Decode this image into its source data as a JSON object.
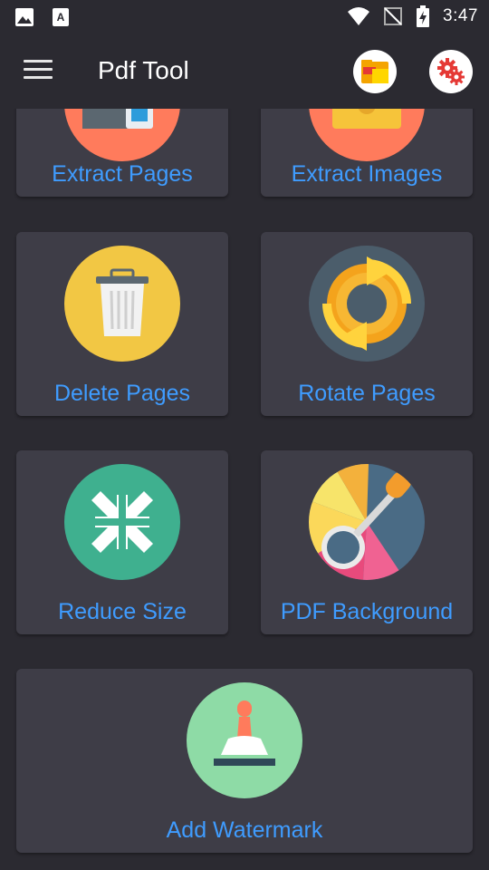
{
  "status_bar": {
    "time": "3:47",
    "left_icons": [
      "image-icon",
      "font-icon"
    ],
    "right_icons": [
      "wifi-icon",
      "no-signal-icon",
      "battery-charging-icon"
    ]
  },
  "app_bar": {
    "title": "Pdf Tool",
    "menu_icon": "hamburger-icon",
    "actions": [
      "folder-icon",
      "settings-gears-icon"
    ]
  },
  "tools": [
    {
      "label": "Extract Pages",
      "icon": "extract-pages-icon",
      "color": "#ff7b5c"
    },
    {
      "label": "Extract Images",
      "icon": "extract-images-icon",
      "color": "#ff7b5c"
    },
    {
      "label": "Delete Pages",
      "icon": "trash-icon",
      "color": "#f2c744"
    },
    {
      "label": "Rotate Pages",
      "icon": "rotate-icon",
      "color": "#4b5d6b"
    },
    {
      "label": "Reduce Size",
      "icon": "compress-icon",
      "color": "#3fb08f"
    },
    {
      "label": "PDF Background",
      "icon": "color-picker-icon",
      "color": "#4a6b85"
    },
    {
      "label": "Add Watermark",
      "icon": "stamp-icon",
      "color": "#8edba6"
    }
  ],
  "colors": {
    "background": "#2b2a31",
    "card": "#3e3d47",
    "label": "#3f9cff"
  }
}
